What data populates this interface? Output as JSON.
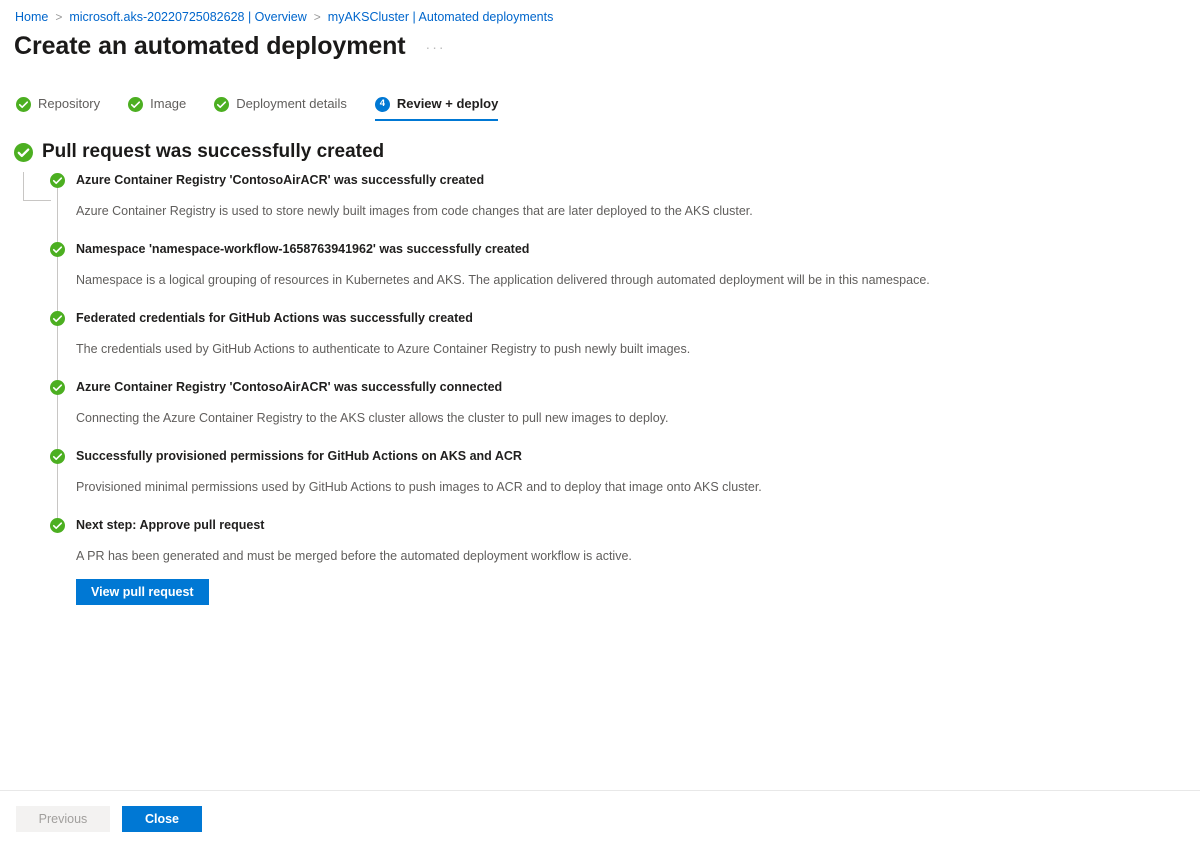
{
  "breadcrumb": {
    "items": [
      {
        "label": "Home",
        "icon": ""
      },
      {
        "label": "microsoft.aks-20220725082628 | Overview",
        "icon": ""
      },
      {
        "label": "myAKSCluster | Automated deployments",
        "icon": ""
      }
    ],
    "separator": ">"
  },
  "header": {
    "title": "Create an automated deployment",
    "more_menu": "···"
  },
  "wizard": {
    "steps": [
      {
        "label": "Repository",
        "state": "complete",
        "icon": "check-circle-icon",
        "number": "1"
      },
      {
        "label": "Image",
        "state": "complete",
        "icon": "check-circle-icon",
        "number": "2"
      },
      {
        "label": "Deployment details",
        "state": "complete",
        "icon": "check-circle-icon",
        "number": "3"
      },
      {
        "label": "Review + deploy",
        "state": "active",
        "icon": "step-number-badge",
        "number": "4"
      }
    ]
  },
  "result": {
    "heading": "Pull request was successfully created",
    "heading_icon": "check-circle-icon",
    "items": [
      {
        "title": "Azure Container Registry 'ContosoAirACR' was successfully created",
        "description": "Azure Container Registry is used to store newly built images from code changes that are later deployed to the AKS cluster.",
        "icon": "check-circle-icon"
      },
      {
        "title": "Namespace 'namespace-workflow-1658763941962' was successfully created",
        "description": "Namespace is a logical grouping of resources in Kubernetes and AKS. The application delivered through automated deployment will be in this namespace.",
        "icon": "check-circle-icon"
      },
      {
        "title": "Federated credentials for GitHub Actions was successfully created",
        "description": "The credentials used by GitHub Actions to authenticate to Azure Container Registry to push newly built images.",
        "icon": "check-circle-icon"
      },
      {
        "title": "Azure Container Registry 'ContosoAirACR' was successfully connected",
        "description": "Connecting the Azure Container Registry to the AKS cluster allows the cluster to pull new images to deploy.",
        "icon": "check-circle-icon"
      },
      {
        "title": "Successfully provisioned permissions for GitHub Actions on AKS and ACR",
        "description": "Provisioned minimal permissions used by GitHub Actions to push images to ACR and to deploy that image onto AKS cluster.",
        "icon": "check-circle-icon"
      },
      {
        "title": "Next step: Approve pull request",
        "description": "A PR has been generated and must be merged before the automated deployment workflow is active.",
        "icon": "check-circle-icon",
        "action_label": "View pull request"
      }
    ]
  },
  "footer": {
    "previous_label": "Previous",
    "close_label": "Close"
  },
  "colors": {
    "accent": "#0078d4",
    "success": "#4caf21",
    "link": "#0066cc",
    "connector": "#c8c6c4",
    "disabled_bg": "#f3f2f1",
    "disabled_text": "#a19f9d"
  }
}
